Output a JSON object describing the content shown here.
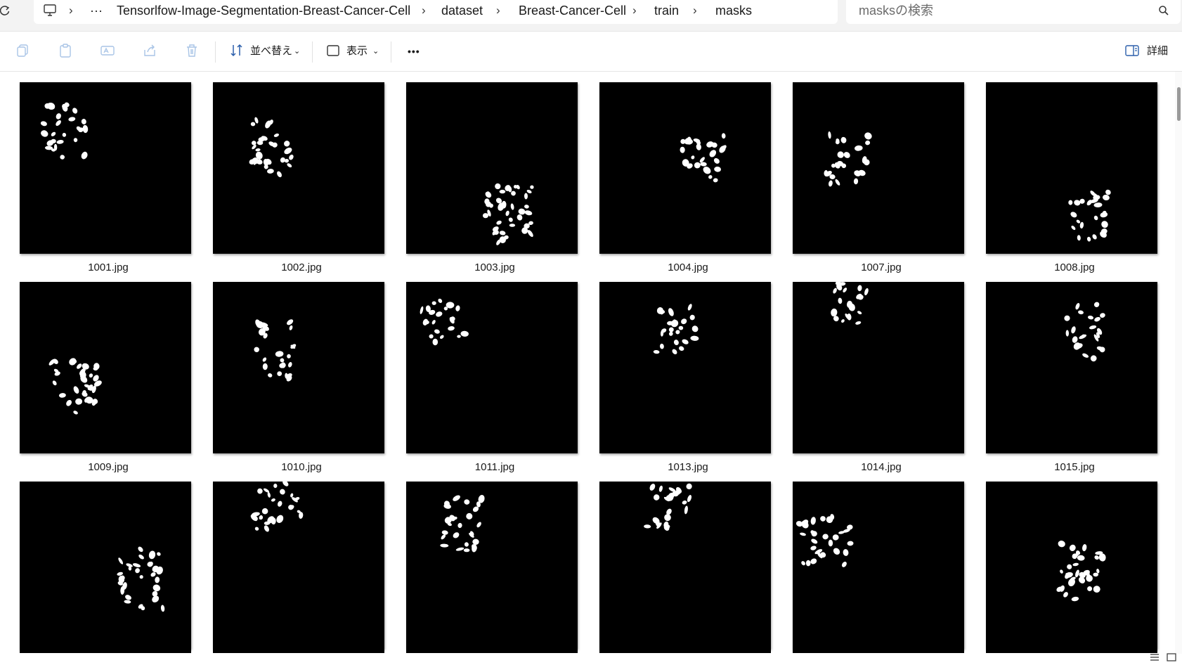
{
  "address_bar": {
    "refresh_icon": "refresh-icon",
    "pc_icon": "computer-icon",
    "overflow_label": "···",
    "separator": "›",
    "breadcrumbs": [
      {
        "label": "Tensorlfow-Image-Segmentation-Breast-Cancer-Cell"
      },
      {
        "label": "dataset"
      },
      {
        "label": "Breast-Cancer-Cell"
      },
      {
        "label": "train"
      },
      {
        "label": "masks"
      }
    ]
  },
  "search": {
    "placeholder": "masksの検索",
    "icon": "search-icon"
  },
  "command_bar": {
    "icons": [
      "copy-icon",
      "paste-icon",
      "rename-icon",
      "share-icon",
      "delete-icon"
    ],
    "sort_label": "並べ替え",
    "view_label": "表示",
    "more_label": "•••",
    "details_label": "詳細"
  },
  "files": [
    {
      "name": "1001.jpg"
    },
    {
      "name": "1002.jpg"
    },
    {
      "name": "1003.jpg"
    },
    {
      "name": "1004.jpg"
    },
    {
      "name": "1007.jpg"
    },
    {
      "name": "1008.jpg"
    },
    {
      "name": "1009.jpg"
    },
    {
      "name": "1010.jpg"
    },
    {
      "name": "1011.jpg"
    },
    {
      "name": "1013.jpg"
    },
    {
      "name": "1014.jpg"
    },
    {
      "name": "1015.jpg"
    },
    {
      "name": ""
    },
    {
      "name": ""
    },
    {
      "name": ""
    },
    {
      "name": ""
    },
    {
      "name": ""
    },
    {
      "name": ""
    }
  ],
  "status_bar": {
    "view_icons": [
      "details-view-icon",
      "large-icons-view-icon"
    ]
  },
  "colors": {
    "thumbnail_background": "#000000",
    "mask_foreground": "#ffffff",
    "chrome_background": "#f3f3f3"
  }
}
